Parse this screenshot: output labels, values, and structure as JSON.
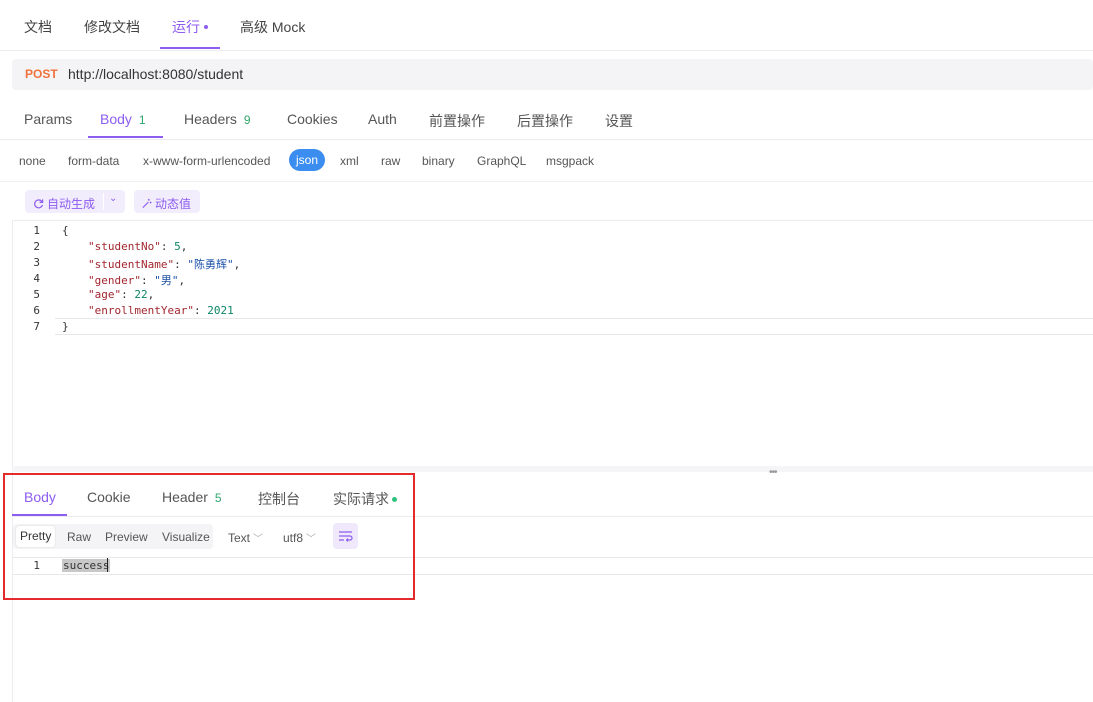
{
  "top_tabs": [
    {
      "label": "文档"
    },
    {
      "label": "修改文档"
    },
    {
      "label": "运行"
    },
    {
      "label": "高级 Mock"
    }
  ],
  "request": {
    "method": "POST",
    "url": "http://localhost:8080/student"
  },
  "request_tabs": [
    {
      "label": "Params"
    },
    {
      "label": "Body",
      "count": "1"
    },
    {
      "label": "Headers",
      "count": "9"
    },
    {
      "label": "Cookies"
    },
    {
      "label": "Auth"
    },
    {
      "label": "前置操作"
    },
    {
      "label": "后置操作"
    },
    {
      "label": "设置"
    }
  ],
  "body_types": [
    "none",
    "form-data",
    "x-www-form-urlencoded",
    "json",
    "xml",
    "raw",
    "binary",
    "GraphQL",
    "msgpack"
  ],
  "body_toolbar": {
    "autogen_label": "自动生成",
    "dynamic_label": "动态值"
  },
  "editor": {
    "line_numbers": [
      "1",
      "2",
      "3",
      "4",
      "5",
      "6",
      "7"
    ],
    "open_brace": "{",
    "close_brace": "}",
    "lines": [
      {
        "key": "\"studentNo\"",
        "value": "5",
        "trail": ","
      },
      {
        "key": "\"studentName\"",
        "value": "\"陈勇辉\"",
        "trail": ","
      },
      {
        "key": "\"gender\"",
        "value": "\"男\"",
        "trail": ","
      },
      {
        "key": "\"age\"",
        "value": "22",
        "trail": ","
      },
      {
        "key": "\"enrollmentYear\"",
        "value": "2021",
        "trail": ""
      }
    ]
  },
  "response": {
    "tabs": [
      {
        "label": "Body"
      },
      {
        "label": "Cookie"
      },
      {
        "label": "Header",
        "count": "5"
      },
      {
        "label": "控制台"
      },
      {
        "label": "实际请求"
      }
    ],
    "formats": [
      "Pretty",
      "Raw",
      "Preview",
      "Visualize"
    ],
    "content_type": "Text",
    "encoding": "utf8",
    "line_number": "1",
    "body": "success"
  },
  "colors": {
    "accent": "#8d5cf0",
    "method_post": "#f0723c",
    "json_pill": "#3b8df0",
    "count_green": "#2ea66b",
    "highlight_box": "#e32b2b"
  }
}
